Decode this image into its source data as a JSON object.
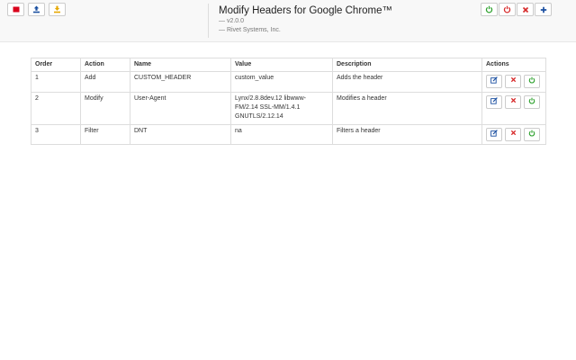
{
  "app": {
    "title": "Modify Headers for Google Chrome™",
    "version": "— v2.0.0",
    "company": "— Rivet Systems, Inc."
  },
  "toolbar_left": [
    {
      "icon": "stop-icon",
      "color": "#d9001b"
    },
    {
      "icon": "export-icon",
      "color": "#1a4fa0"
    },
    {
      "icon": "import-icon",
      "color": "#e6a800"
    }
  ],
  "toolbar_right": [
    {
      "icon": "power-on-icon",
      "color": "#2ca02c"
    },
    {
      "icon": "power-off-icon",
      "color": "#d62728"
    },
    {
      "icon": "close-icon",
      "color": "#d62728"
    },
    {
      "icon": "plus-icon",
      "color": "#1a4fa0"
    }
  ],
  "table": {
    "columns": [
      "Order",
      "Action",
      "Name",
      "Value",
      "Description",
      "Actions"
    ],
    "rows": [
      {
        "order": "1",
        "action": "Add",
        "name": "CUSTOM_HEADER",
        "value": "custom_value",
        "description": "Adds the header"
      },
      {
        "order": "2",
        "action": "Modify",
        "name": "User-Agent",
        "value": "Lynx/2.8.8dev.12 libwww-FM/2.14 SSL-MM/1.4.1 GNUTLS/2.12.14",
        "description": "Modifies a header"
      },
      {
        "order": "3",
        "action": "Filter",
        "name": "DNT",
        "value": "na",
        "description": "Filters a header"
      }
    ]
  },
  "row_action_icons": [
    "edit-icon",
    "delete-icon",
    "toggle-icon"
  ],
  "colors": {
    "edit": "#1a4fa0",
    "delete": "#d62728",
    "toggle": "#2ca02c",
    "value_filtered": "#d9534f"
  }
}
